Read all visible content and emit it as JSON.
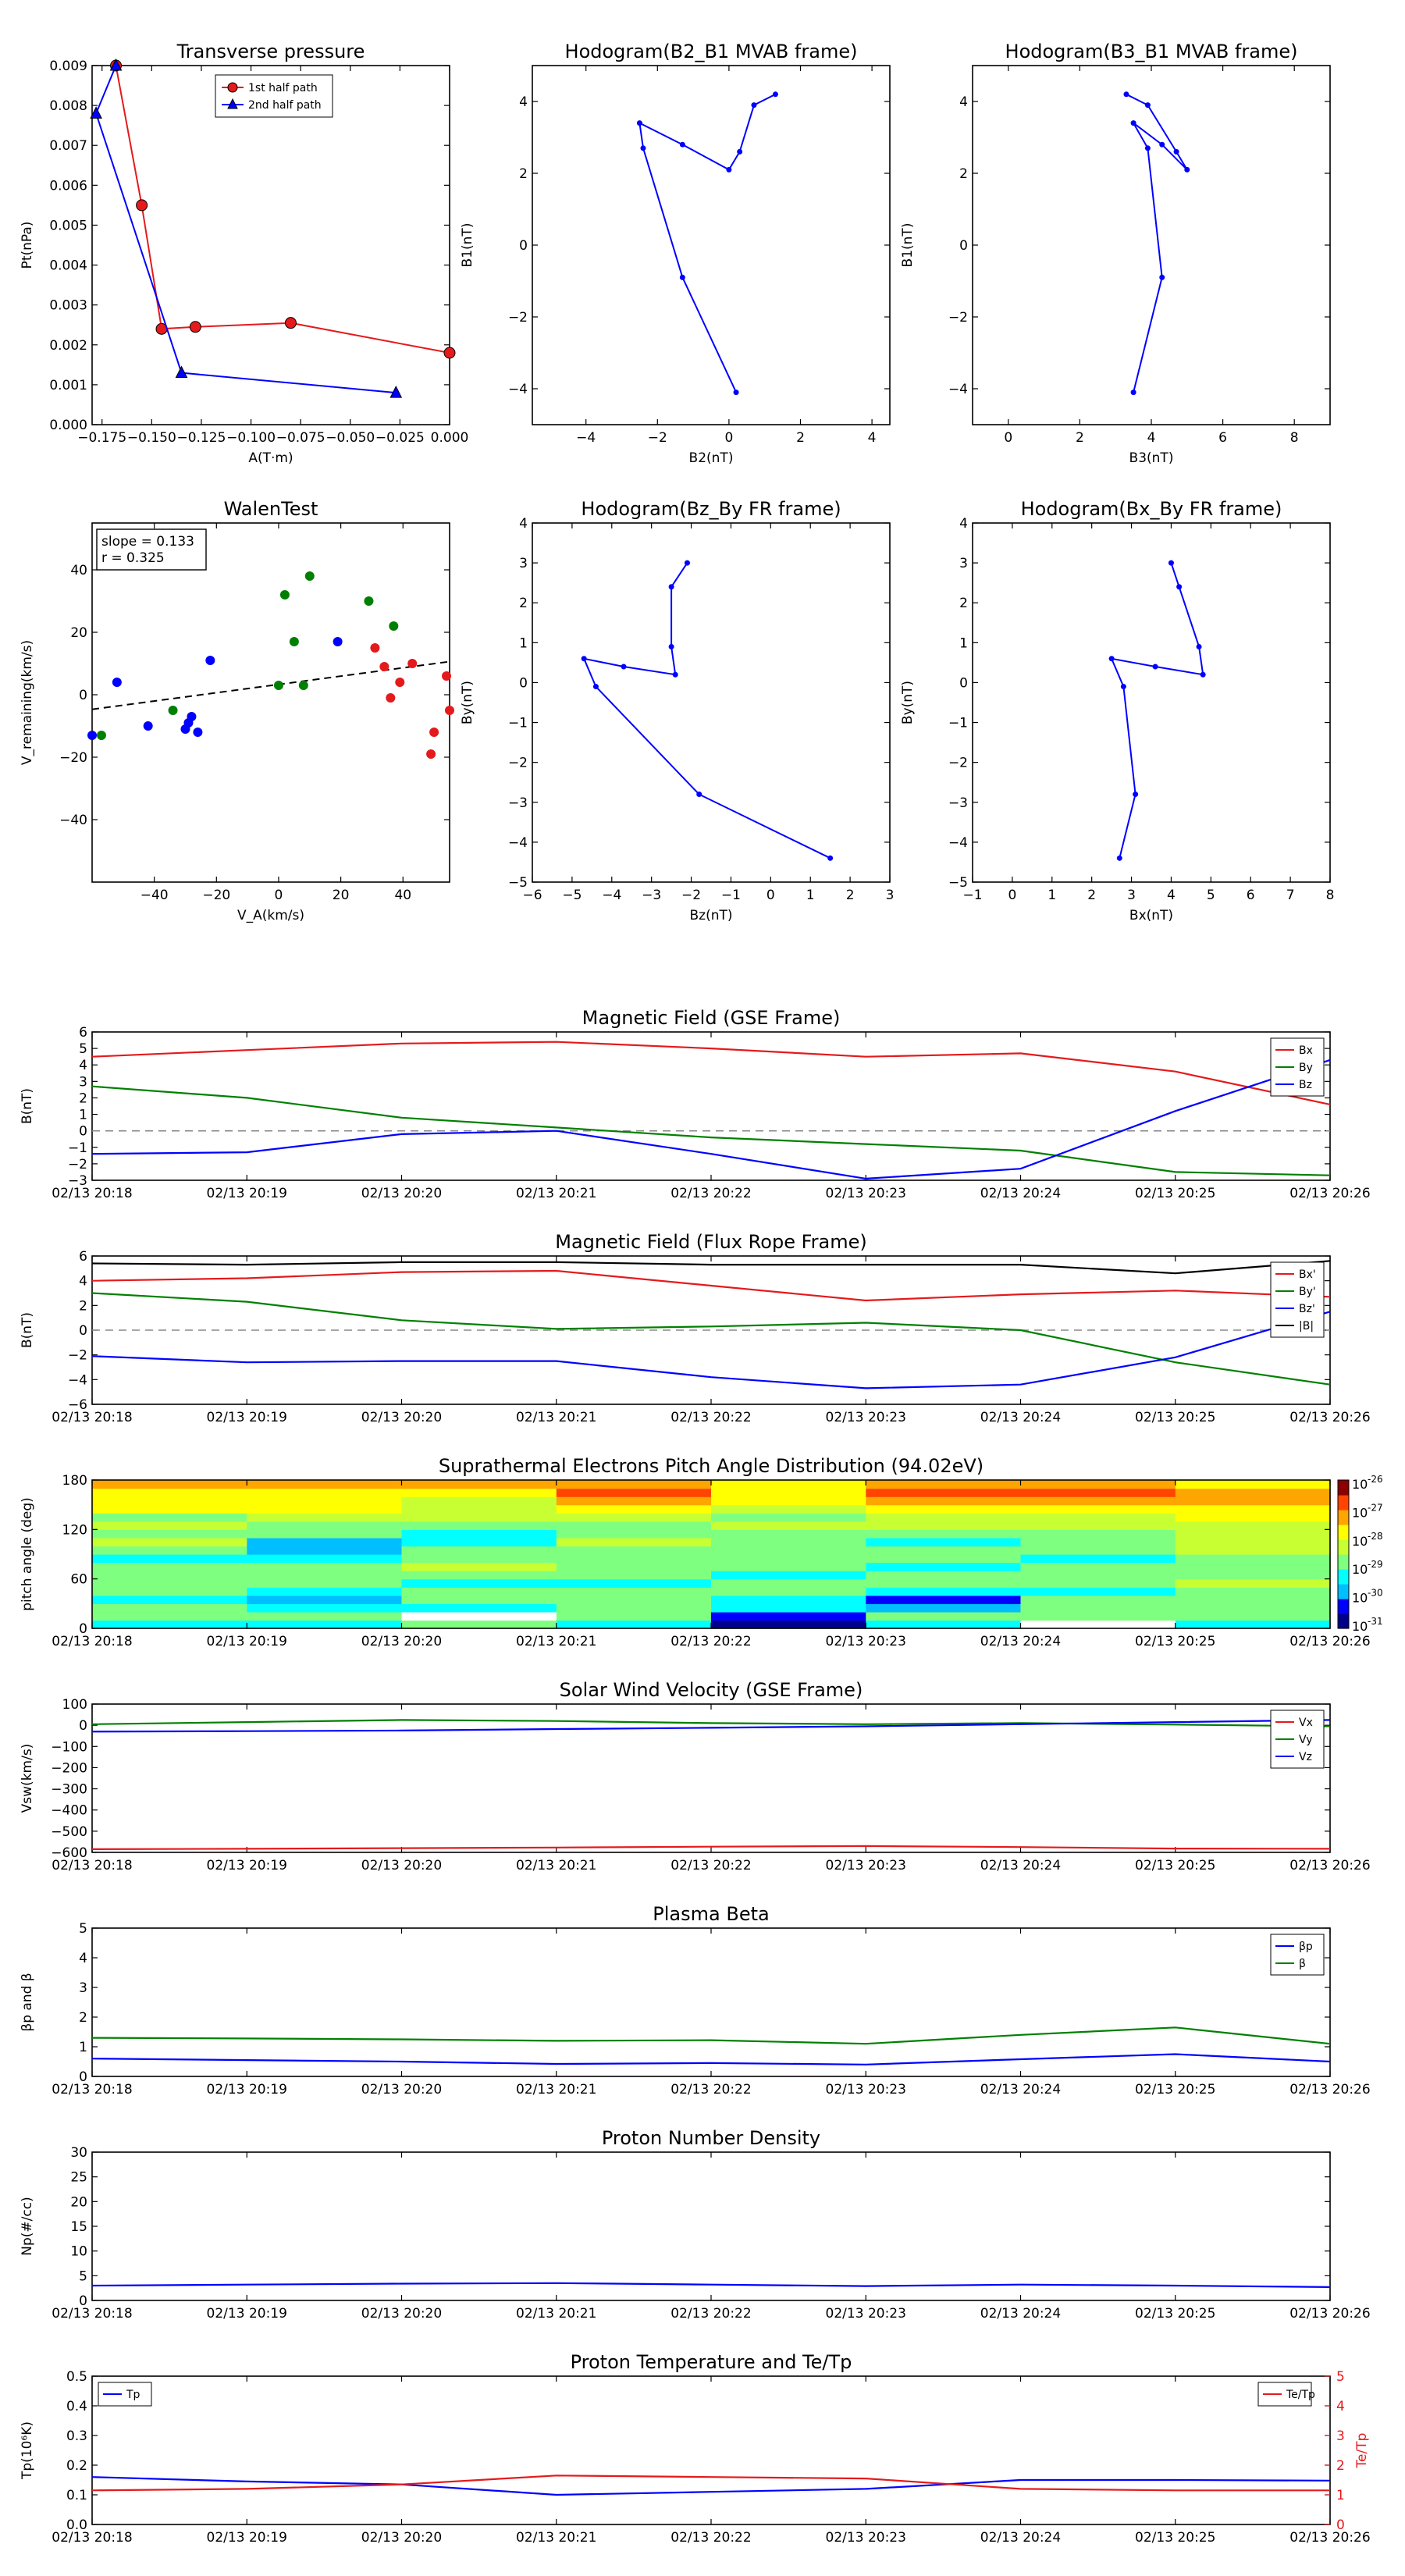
{
  "time_ticks": [
    "02/13 20:18",
    "02/13 20:19",
    "02/13 20:20",
    "02/13 20:21",
    "02/13 20:22",
    "02/13 20:23",
    "02/13 20:24",
    "02/13 20:25",
    "02/13 20:26"
  ],
  "chart_data": [
    {
      "id": "pt",
      "type": "line",
      "title": "Transverse pressure",
      "xlabel": "A(T·m)",
      "ylabel": "Pt(nPa)",
      "xlim": [
        -0.18,
        0.0
      ],
      "ylim": [
        0,
        0.009
      ],
      "xticks": [
        "−0.175",
        "−0.150",
        "−0.125",
        "−0.100",
        "−0.075",
        "−0.050",
        "−0.025",
        "0.000"
      ],
      "yticks": [
        "0.000",
        "0.001",
        "0.002",
        "0.003",
        "0.004",
        "0.005",
        "0.006",
        "0.007",
        "0.008",
        "0.009"
      ],
      "legend_position": "top-center",
      "series": [
        {
          "name": "1st half path",
          "color": "#e41a1c",
          "marker": "circle",
          "x": [
            -0.168,
            -0.155,
            -0.145,
            -0.128,
            -0.08,
            0.0
          ],
          "y": [
            0.009,
            0.0055,
            0.0024,
            0.00245,
            0.00255,
            0.0018
          ]
        },
        {
          "name": "2nd half path",
          "color": "#0000ff",
          "marker": "triangle",
          "x": [
            -0.168,
            -0.178,
            -0.135,
            -0.027
          ],
          "y": [
            0.009,
            0.0078,
            0.0013,
            0.0008
          ]
        }
      ]
    },
    {
      "id": "h1",
      "type": "line",
      "title": "Hodogram(B2_B1 MVAB frame)",
      "xlabel": "B2(nT)",
      "ylabel": "B1(nT)",
      "xlim": [
        -5.5,
        4.5
      ],
      "ylim": [
        -5,
        5
      ],
      "xticks": [
        "−4",
        "−2",
        "0",
        "2",
        "4"
      ],
      "yticks": [
        "−4",
        "−2",
        "0",
        "2",
        "4"
      ],
      "series": [
        {
          "color": "#0000ff",
          "x": [
            0.2,
            -1.3,
            -2.4,
            -2.5,
            -1.3,
            0.0,
            0.3,
            0.7,
            1.3
          ],
          "y": [
            -4.1,
            -0.9,
            2.7,
            3.4,
            2.8,
            2.1,
            2.6,
            3.9,
            4.2
          ]
        }
      ]
    },
    {
      "id": "h2",
      "type": "line",
      "title": "Hodogram(B3_B1 MVAB frame)",
      "xlabel": "B3(nT)",
      "ylabel": "B1(nT)",
      "xlim": [
        -1,
        9
      ],
      "ylim": [
        -5,
        5
      ],
      "xticks": [
        "0",
        "2",
        "4",
        "6",
        "8"
      ],
      "yticks": [
        "−4",
        "−2",
        "0",
        "2",
        "4"
      ],
      "series": [
        {
          "color": "#0000ff",
          "x": [
            3.5,
            4.3,
            3.9,
            3.5,
            4.3,
            5.0,
            4.7,
            3.9,
            3.3
          ],
          "y": [
            -4.1,
            -0.9,
            2.7,
            3.4,
            2.8,
            2.1,
            2.6,
            3.9,
            4.2
          ]
        }
      ]
    },
    {
      "id": "walen",
      "type": "scatter",
      "title": "WalenTest",
      "xlabel": "V_A(km/s)",
      "ylabel": "V_remaining(km/s)",
      "xlim": [
        -60,
        55
      ],
      "ylim": [
        -60,
        55
      ],
      "xticks": [
        "−40",
        "−20",
        "0",
        "20",
        "40"
      ],
      "yticks": [
        "−40",
        "−20",
        "0",
        "20",
        "40"
      ],
      "annotation": [
        "slope = 0.133",
        "r = 0.325"
      ],
      "fit_line": {
        "slope": 0.133,
        "intercept": 3.3
      },
      "series": [
        {
          "color": "#008000",
          "x": [
            -57,
            -34,
            0,
            2,
            5,
            8,
            10,
            29,
            37
          ],
          "y": [
            -13,
            -5,
            3,
            32,
            17,
            3,
            38,
            30,
            22
          ]
        },
        {
          "color": "#0000ff",
          "x": [
            -60,
            -52,
            -42,
            -30,
            -29,
            -28,
            -26,
            -22,
            19
          ],
          "y": [
            -13,
            4,
            -10,
            -11,
            -9,
            -7,
            -12,
            11,
            17
          ]
        },
        {
          "color": "#e41a1c",
          "x": [
            31,
            34,
            36,
            39,
            43,
            49,
            50,
            54,
            55
          ],
          "y": [
            15,
            9,
            -1,
            4,
            10,
            -19,
            -12,
            6,
            -5
          ]
        }
      ]
    },
    {
      "id": "h3",
      "type": "line",
      "title": "Hodogram(Bz_By FR frame)",
      "xlabel": "Bz(nT)",
      "ylabel": "By(nT)",
      "xlim": [
        -6,
        3
      ],
      "ylim": [
        -5,
        4
      ],
      "xticks": [
        "−6",
        "−5",
        "−4",
        "−3",
        "−2",
        "−1",
        "0",
        "1",
        "2",
        "3"
      ],
      "yticks": [
        "−5",
        "−4",
        "−3",
        "−2",
        "−1",
        "0",
        "1",
        "2",
        "3",
        "4"
      ],
      "series": [
        {
          "color": "#0000ff",
          "x": [
            1.5,
            -1.8,
            -4.4,
            -4.7,
            -3.7,
            -2.4,
            -2.5,
            -2.5,
            -2.1
          ],
          "y": [
            -4.4,
            -2.8,
            -0.1,
            0.6,
            0.4,
            0.2,
            0.9,
            2.4,
            3.0
          ]
        }
      ]
    },
    {
      "id": "h4",
      "type": "line",
      "title": "Hodogram(Bx_By FR frame)",
      "xlabel": "Bx(nT)",
      "ylabel": "By(nT)",
      "xlim": [
        -1,
        8
      ],
      "ylim": [
        -5,
        4
      ],
      "xticks": [
        "−1",
        "0",
        "1",
        "2",
        "3",
        "4",
        "5",
        "6",
        "7",
        "8"
      ],
      "yticks": [
        "−5",
        "−4",
        "−3",
        "−2",
        "−1",
        "0",
        "1",
        "2",
        "3",
        "4"
      ],
      "series": [
        {
          "color": "#0000ff",
          "x": [
            2.7,
            3.1,
            2.8,
            2.5,
            3.6,
            4.8,
            4.7,
            4.2,
            4.0
          ],
          "y": [
            -4.4,
            -2.8,
            -0.1,
            0.6,
            0.4,
            0.2,
            0.9,
            2.4,
            3.0
          ]
        }
      ]
    },
    {
      "id": "bgse",
      "type": "line",
      "title": "Magnetic Field (GSE Frame)",
      "ylabel": "B(nT)",
      "ylim": [
        -3,
        6
      ],
      "yticks": [
        "−3",
        "−2",
        "−1",
        "0",
        "1",
        "2",
        "3",
        "4",
        "5",
        "6"
      ],
      "zero_line": true,
      "legend_position": "top-right",
      "series": [
        {
          "name": "Bx",
          "color": "#e41a1c",
          "y": [
            4.5,
            4.9,
            5.3,
            5.4,
            5.0,
            4.5,
            4.7,
            3.6,
            1.6
          ]
        },
        {
          "name": "By",
          "color": "#008000",
          "y": [
            2.7,
            2.0,
            0.8,
            0.2,
            -0.4,
            -0.8,
            -1.2,
            -2.5,
            -2.7
          ]
        },
        {
          "name": "Bz",
          "color": "#0000ff",
          "y": [
            -1.4,
            -1.3,
            -0.2,
            0.0,
            -1.4,
            -2.9,
            -2.3,
            1.2,
            4.3
          ]
        }
      ]
    },
    {
      "id": "bfr",
      "type": "line",
      "title": "Magnetic Field (Flux Rope Frame)",
      "ylabel": "B(nT)",
      "ylim": [
        -6,
        6
      ],
      "yticks": [
        "−6",
        "−4",
        "−2",
        "0",
        "2",
        "4",
        "6"
      ],
      "zero_line": true,
      "legend_position": "top-right",
      "series": [
        {
          "name": "Bx'",
          "color": "#e41a1c",
          "y": [
            4.0,
            4.2,
            4.7,
            4.8,
            3.6,
            2.4,
            2.9,
            3.2,
            2.7
          ]
        },
        {
          "name": "By'",
          "color": "#008000",
          "y": [
            3.0,
            2.3,
            0.8,
            0.1,
            0.3,
            0.6,
            0.0,
            -2.6,
            -4.4
          ]
        },
        {
          "name": "Bz'",
          "color": "#0000ff",
          "y": [
            -2.1,
            -2.6,
            -2.5,
            -2.5,
            -3.8,
            -4.7,
            -4.4,
            -2.2,
            1.5
          ]
        },
        {
          "name": "|B|",
          "color": "#000000",
          "y": [
            5.4,
            5.3,
            5.5,
            5.5,
            5.3,
            5.3,
            5.3,
            4.6,
            5.6
          ]
        }
      ]
    },
    {
      "id": "pad",
      "type": "heatmap",
      "title": "Suprathermal Electrons Pitch Angle Distribution (94.02eV)",
      "ylabel": "pitch angle (deg)",
      "ylim": [
        0,
        180
      ],
      "yticks": [
        "0",
        "60",
        "120",
        "180"
      ],
      "colorbar_ticks": [
        "10",
        "-31",
        "10",
        "-30",
        "10",
        "-29",
        "10",
        "-28",
        "10",
        "-27",
        "10",
        "-26"
      ],
      "colorbar_labels": [
        {
          "base": "10",
          "exp": "-26"
        },
        {
          "base": "10",
          "exp": "-27"
        },
        {
          "base": "10",
          "exp": "-28"
        },
        {
          "base": "10",
          "exp": "-29"
        },
        {
          "base": "10",
          "exp": "-30"
        },
        {
          "base": "10",
          "exp": "-31"
        }
      ],
      "colormap": [
        "#00008b",
        "#0000ff",
        "#00bfff",
        "#00ffff",
        "#7fff7f",
        "#c8ff32",
        "#ffff00",
        "#ffa500",
        "#ff4500",
        "#8b0000"
      ],
      "time_bins": 8,
      "angle_bins": 18,
      "levels": [
        [
          3,
          4,
          4,
          3,
          4,
          4,
          4,
          4,
          3,
          4,
          5,
          4,
          5,
          4,
          6,
          6,
          6,
          7
        ],
        [
          3,
          4,
          3,
          2,
          3,
          4,
          4,
          4,
          3,
          2,
          2,
          4,
          4,
          5,
          6,
          6,
          6,
          7
        ],
        [
          4,
          -1,
          3,
          4,
          4,
          3,
          4,
          5,
          4,
          4,
          3,
          3,
          4,
          5,
          5,
          5,
          6,
          7
        ],
        [
          3,
          4,
          4,
          4,
          4,
          3,
          4,
          4,
          4,
          4,
          5,
          4,
          4,
          5,
          6,
          7,
          8,
          7
        ],
        [
          0,
          1,
          3,
          3,
          4,
          4,
          3,
          4,
          4,
          4,
          4,
          4,
          5,
          4,
          5,
          6,
          6,
          6
        ],
        [
          3,
          4,
          2,
          1,
          3,
          4,
          4,
          3,
          4,
          4,
          3,
          4,
          5,
          5,
          6,
          7,
          8,
          7
        ],
        [
          -1,
          4,
          4,
          4,
          3,
          4,
          4,
          4,
          3,
          4,
          4,
          4,
          5,
          5,
          6,
          7,
          8,
          7
        ],
        [
          3,
          4,
          4,
          4,
          4,
          5,
          4,
          4,
          4,
          5,
          5,
          5,
          5,
          6,
          6,
          7,
          7,
          6
        ]
      ]
    },
    {
      "id": "vsw",
      "type": "line",
      "title": "Solar Wind Velocity (GSE Frame)",
      "ylabel": "Vsw(km/s)",
      "ylim": [
        -600,
        100
      ],
      "yticks": [
        "−600",
        "−500",
        "−400",
        "−300",
        "−200",
        "−100",
        "0",
        "100"
      ],
      "legend_position": "top-right",
      "series": [
        {
          "name": "Vx",
          "color": "#e41a1c",
          "y": [
            -585,
            -583,
            -580,
            -577,
            -573,
            -570,
            -575,
            -582,
            -583
          ]
        },
        {
          "name": "Vy",
          "color": "#008000",
          "y": [
            5,
            15,
            25,
            20,
            10,
            5,
            10,
            3,
            -5
          ]
        },
        {
          "name": "Vz",
          "color": "#0000ff",
          "y": [
            -30,
            -28,
            -25,
            -18,
            -12,
            -5,
            5,
            15,
            25
          ]
        }
      ]
    },
    {
      "id": "beta",
      "type": "line",
      "title": "Plasma Beta",
      "ylabel": "βp and β",
      "ylim": [
        0,
        5
      ],
      "yticks": [
        "0",
        "1",
        "2",
        "3",
        "4",
        "5"
      ],
      "legend_position": "top-right",
      "series": [
        {
          "name": "βp",
          "color": "#0000ff",
          "y": [
            0.6,
            0.55,
            0.5,
            0.42,
            0.45,
            0.4,
            0.58,
            0.75,
            0.5
          ]
        },
        {
          "name": "β",
          "color": "#008000",
          "y": [
            1.3,
            1.28,
            1.25,
            1.2,
            1.22,
            1.1,
            1.4,
            1.65,
            1.1
          ]
        }
      ]
    },
    {
      "id": "np",
      "type": "line",
      "title": "Proton Number Density",
      "ylabel": "Np(#/cc)",
      "ylim": [
        0,
        30
      ],
      "yticks": [
        "0",
        "5",
        "10",
        "15",
        "20",
        "25",
        "30"
      ],
      "series": [
        {
          "color": "#0000ff",
          "y": [
            3.0,
            3.2,
            3.4,
            3.5,
            3.2,
            2.9,
            3.2,
            3.0,
            2.7
          ]
        }
      ]
    },
    {
      "id": "tp",
      "type": "line",
      "title": "Proton Temperature and Te/Tp",
      "ylabel": "Tp(10⁶K)",
      "ylim": [
        0,
        0.5
      ],
      "yticks": [
        "0.0",
        "0.1",
        "0.2",
        "0.3",
        "0.4",
        "0.5"
      ],
      "y2label": "Te/Tp",
      "y2lim": [
        0,
        5
      ],
      "y2ticks": [
        "0",
        "1",
        "2",
        "3",
        "4",
        "5"
      ],
      "series": [
        {
          "name": "Tp",
          "color": "#0000ff",
          "axis": "left",
          "legend_position": "top-left",
          "y": [
            0.16,
            0.145,
            0.135,
            0.1,
            0.11,
            0.12,
            0.15,
            0.15,
            0.148
          ]
        },
        {
          "name": "Te/Tp",
          "color": "#e41a1c",
          "axis": "right",
          "legend_position": "top-right",
          "y": [
            1.15,
            1.2,
            1.35,
            1.65,
            1.6,
            1.55,
            1.2,
            1.15,
            1.15
          ]
        }
      ]
    }
  ]
}
